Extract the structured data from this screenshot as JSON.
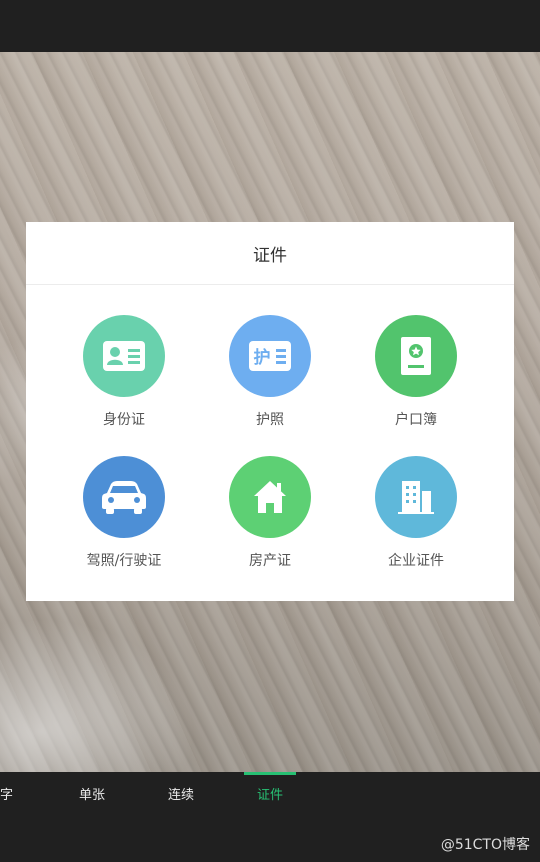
{
  "dialog": {
    "title": "证件",
    "options": [
      {
        "label": "身份证",
        "icon": "id-card-icon",
        "color": "#69d1ad"
      },
      {
        "label": "护照",
        "icon": "passport-icon",
        "color": "#6eaef0",
        "icon_text": "护"
      },
      {
        "label": "户口簿",
        "icon": "household-register-icon",
        "color": "#52c46d"
      },
      {
        "label": "驾照/行驶证",
        "icon": "car-icon",
        "color": "#4d8fd6"
      },
      {
        "label": "房产证",
        "icon": "house-icon",
        "color": "#5dd074"
      },
      {
        "label": "企业证件",
        "icon": "building-icon",
        "color": "#5fb8da"
      }
    ]
  },
  "tabs": [
    {
      "label": "字",
      "active": false
    },
    {
      "label": "单张",
      "active": false
    },
    {
      "label": "连续",
      "active": false
    },
    {
      "label": "证件",
      "active": true
    }
  ],
  "colors": {
    "accent": "#27c073",
    "bar": "#202020"
  },
  "watermark": "@51CTO博客"
}
